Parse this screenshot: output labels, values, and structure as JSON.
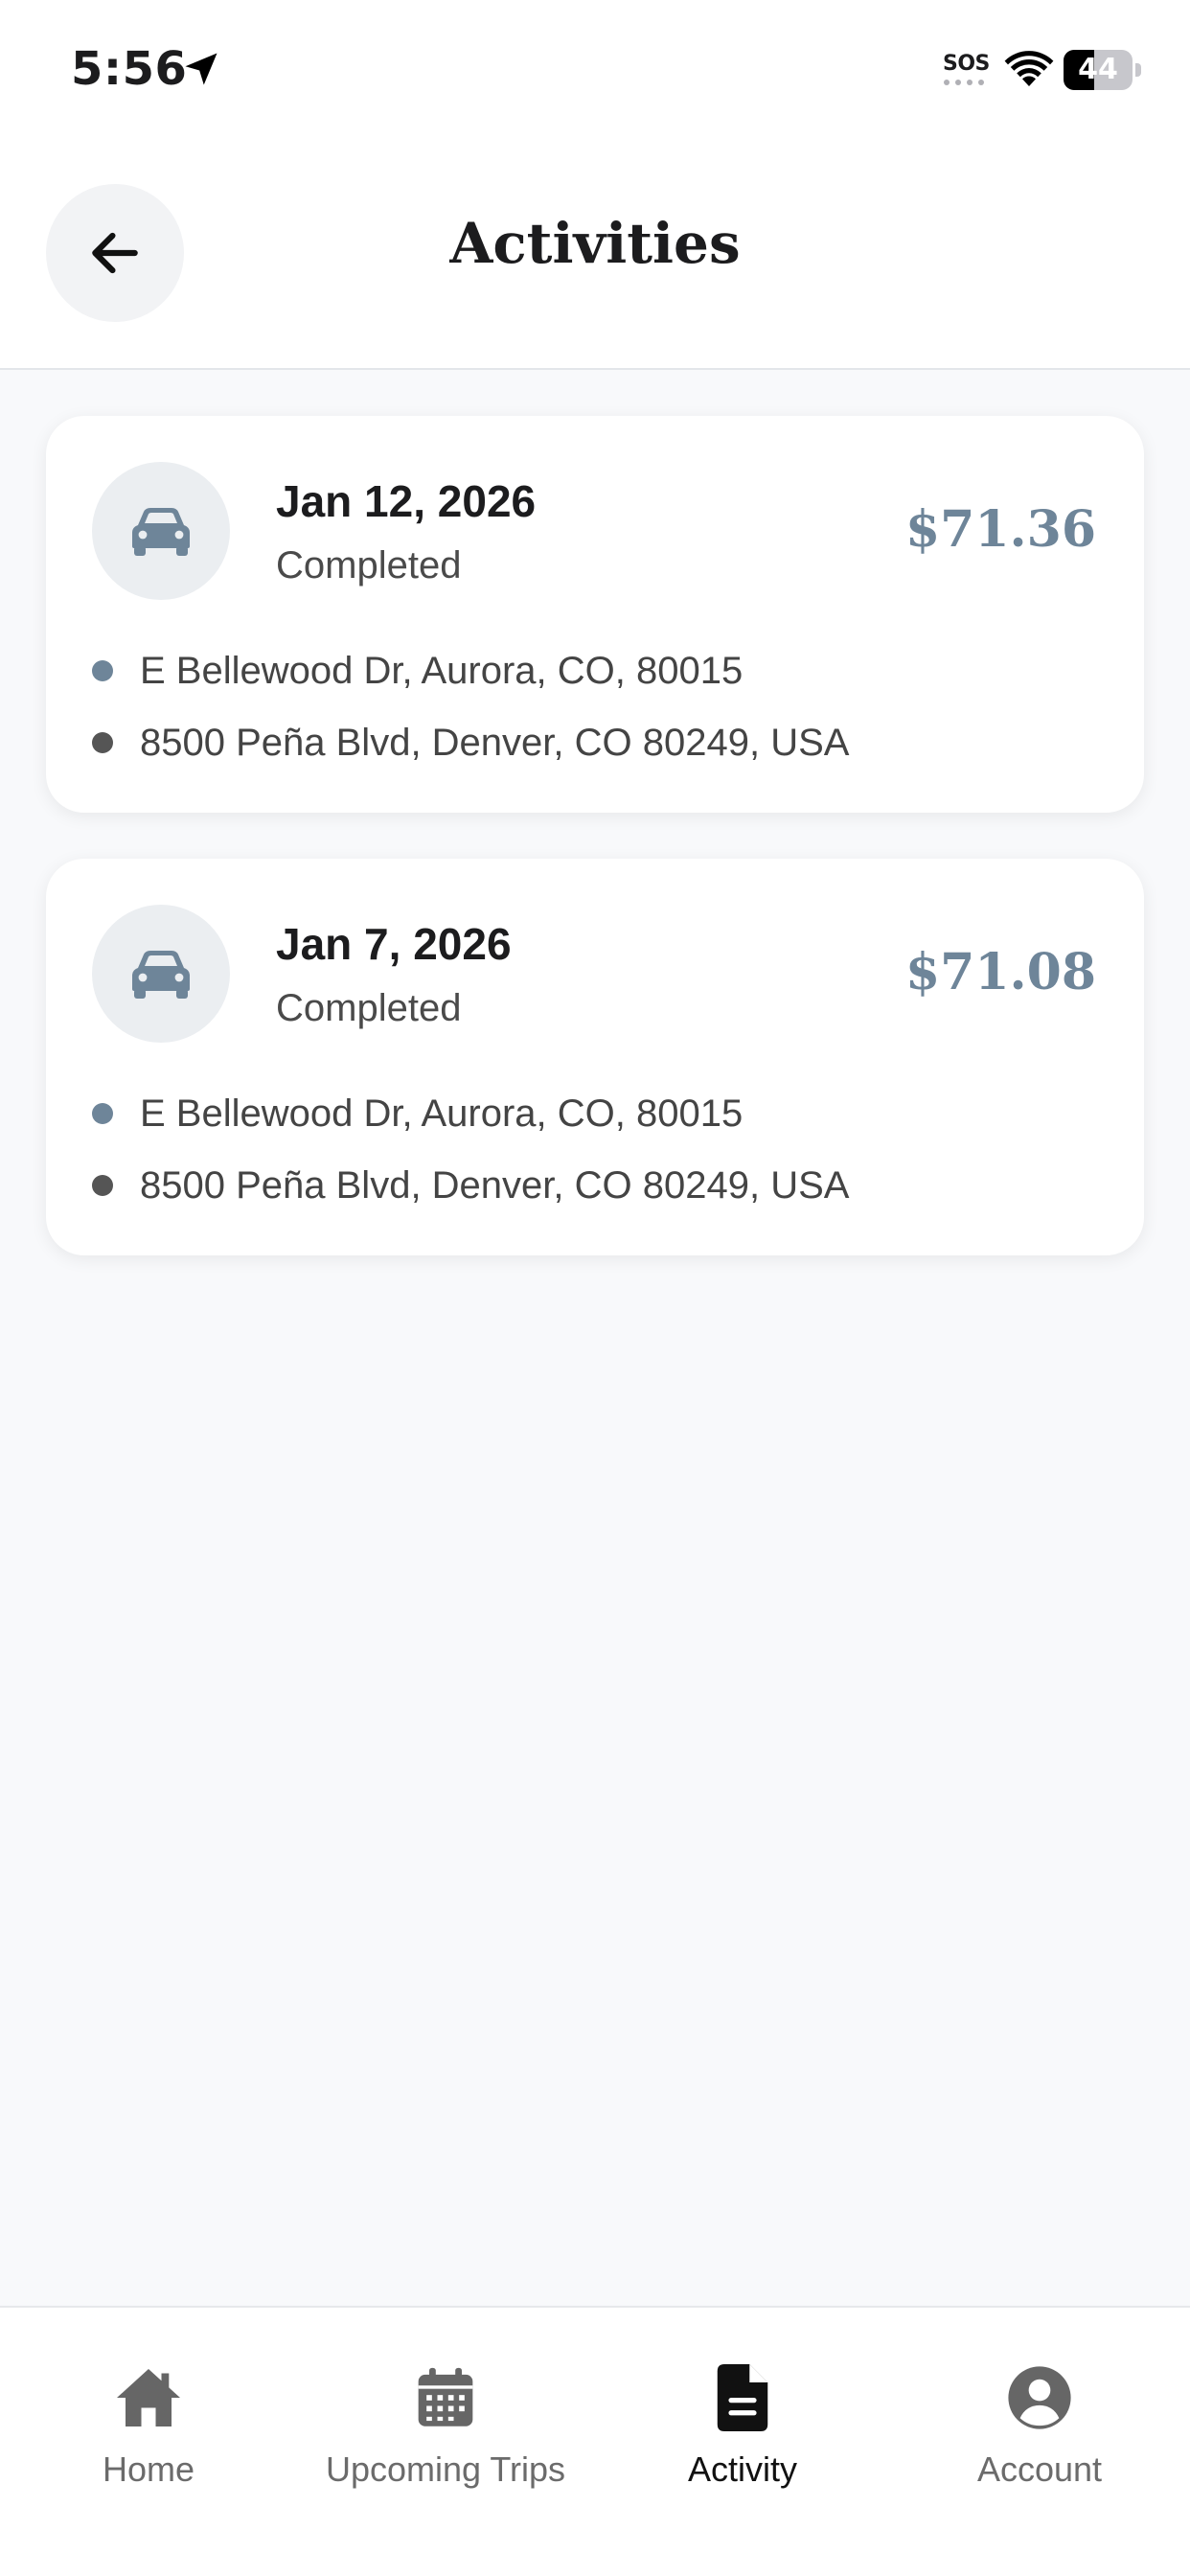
{
  "status_bar": {
    "time": "5:56",
    "sos": "SOS",
    "battery_percent": "44",
    "battery_level": 0.44
  },
  "header": {
    "title": "Activities",
    "back_icon": "arrow-left-icon"
  },
  "activities": [
    {
      "date": "Jan 12, 2026",
      "status": "Completed",
      "price": "$71.36",
      "pickup": "E Bellewood Dr, Aurora, CO, 80015",
      "dropoff": "8500 Peña Blvd, Denver, CO 80249, USA",
      "icon": "car-icon"
    },
    {
      "date": "Jan 7, 2026",
      "status": "Completed",
      "price": "$71.08",
      "pickup": "E Bellewood Dr, Aurora, CO, 80015",
      "dropoff": "8500 Peña Blvd, Denver, CO 80249, USA",
      "icon": "car-icon"
    }
  ],
  "bottom_nav": {
    "items": [
      {
        "label": "Home",
        "icon": "home-icon",
        "active": false
      },
      {
        "label": "Upcoming Trips",
        "icon": "calendar-icon",
        "active": false
      },
      {
        "label": "Activity",
        "icon": "document-icon",
        "active": true
      },
      {
        "label": "Account",
        "icon": "account-circle-icon",
        "active": false
      }
    ]
  },
  "colors": {
    "accent": "#6E8599",
    "pickup_dot": "#6E8599",
    "dropoff_dot": "#555555",
    "background": "#F8F9FB",
    "active_nav": "#111111",
    "inactive_nav": "#6B6B6B"
  }
}
